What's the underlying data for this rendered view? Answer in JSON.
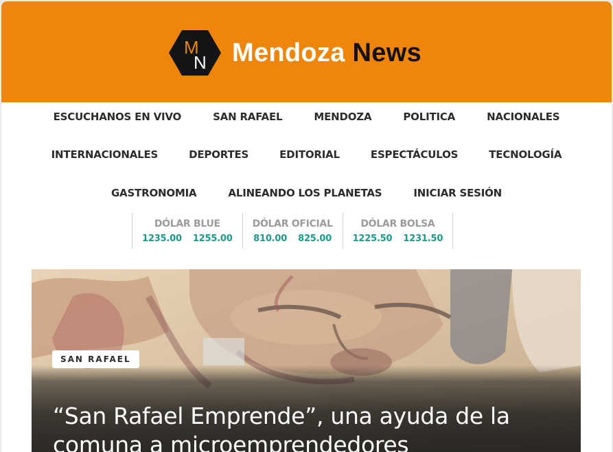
{
  "header": {
    "brand_part1": "Mendoza",
    "brand_part2": "News",
    "logo_monogram_top": "M",
    "logo_monogram_bottom": "N",
    "background_color": "#ee860d"
  },
  "nav": {
    "row1": [
      "ESCUCHANOS EN VIVO",
      "SAN RAFAEL",
      "MENDOZA",
      "POLITICA",
      "NACIONALES"
    ],
    "row2": [
      "INTERNACIONALES",
      "DEPORTES",
      "EDITORIAL",
      "ESPECTÁCULOS",
      "TECNOLOGÍA"
    ],
    "row3": [
      "GASTRONOMIA",
      "ALINEANDO LOS PLANETAS",
      "INICIAR SESIÓN"
    ]
  },
  "rates": [
    {
      "title": "DÓLAR BLUE",
      "buy": "1235.00",
      "sell": "1255.00"
    },
    {
      "title": "DÓLAR OFICIAL",
      "buy": "810.00",
      "sell": "825.00"
    },
    {
      "title": "DÓLAR BOLSA",
      "buy": "1225.50",
      "sell": "1231.50"
    }
  ],
  "featured": {
    "category": "SAN RAFAEL",
    "headline": "“San Rafael Emprende”, una ayuda de la comuna a microemprendedores",
    "image_icon": "artwork-face-image"
  },
  "colors": {
    "accent": "#ee860d",
    "rate_value": "#1a9a8a",
    "rate_title": "#9b9b9b",
    "nav_text": "#2b2b2b"
  }
}
